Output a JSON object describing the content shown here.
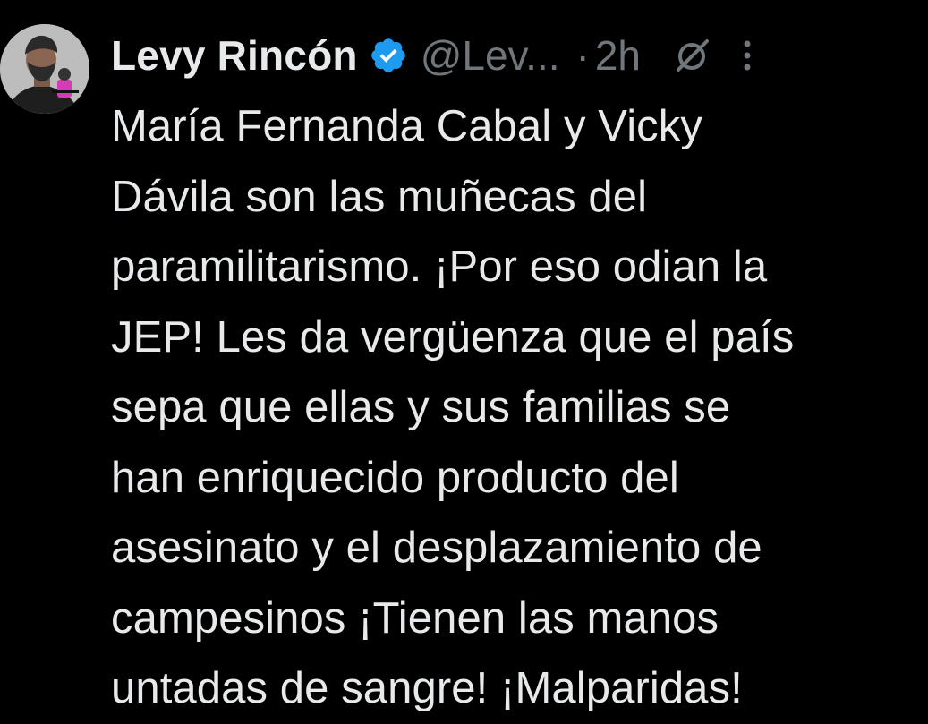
{
  "author": {
    "display_name": "Levy Rincón",
    "handle": "@Lev...",
    "separator": "·",
    "time_ago": "2h"
  },
  "icons": {
    "verified": "verified-badge-icon",
    "grok": "grok-icon",
    "more": "more-options-icon",
    "avatar": "avatar"
  },
  "tweet": {
    "text": "María Fernanda Cabal y Vicky\nDávila son las muñecas del\nparamilitarismo. ¡Por eso odian la\nJEP! Les da vergüenza que el país\nsepa que ellas y sus familias se\nhan enriquecido producto del\nasesinato y el desplazamiento de\ncampesinos ¡Tienen las manos\nuntadas de sangre! ¡Malparidas!"
  },
  "colors": {
    "background": "#000000",
    "text_primary": "#e7e9ea",
    "text_secondary": "#71767b",
    "verified_blue": "#1d9bf0"
  }
}
